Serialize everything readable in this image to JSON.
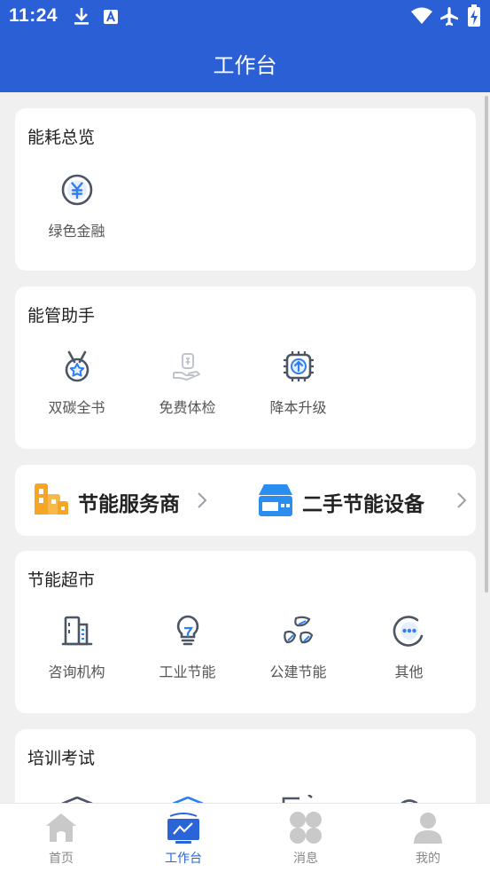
{
  "status_bar": {
    "time": "11:24"
  },
  "header": {
    "title": "工作台"
  },
  "energy_overview": {
    "title": "能耗总览",
    "items": [
      {
        "label": "绿色金融",
        "icon": "yuan-coin-icon"
      }
    ]
  },
  "energy_assistant": {
    "title": "能管助手",
    "items": [
      {
        "label": "双碳全书",
        "icon": "medal-icon"
      },
      {
        "label": "免费体检",
        "icon": "hand-money-icon"
      },
      {
        "label": "降本升级",
        "icon": "chip-upgrade-icon"
      }
    ]
  },
  "promos": {
    "service_provider": {
      "label": "节能服务商",
      "icon": "buildings-icon"
    },
    "second_hand": {
      "label": "二手节能设备",
      "icon": "device-box-icon"
    }
  },
  "supermarket": {
    "title": "节能超市",
    "items": [
      {
        "label": "咨询机构",
        "icon": "office-building-icon"
      },
      {
        "label": "工业节能",
        "icon": "lightbulb-icon"
      },
      {
        "label": "公建节能",
        "icon": "leaves-icon"
      },
      {
        "label": "其他",
        "icon": "more-icon"
      }
    ]
  },
  "training": {
    "title": "培训考试"
  },
  "tab_bar": {
    "tabs": [
      {
        "label": "首页",
        "icon": "home-icon"
      },
      {
        "label": "工作台",
        "icon": "workbench-icon",
        "active": true
      },
      {
        "label": "消息",
        "icon": "message-icon"
      },
      {
        "label": "我的",
        "icon": "profile-icon"
      }
    ]
  },
  "colors": {
    "primary": "#2a5fd6",
    "tab_active": "#2a64d8",
    "promo_orange": "#f6a623",
    "promo_blue": "#2a8ef0"
  }
}
